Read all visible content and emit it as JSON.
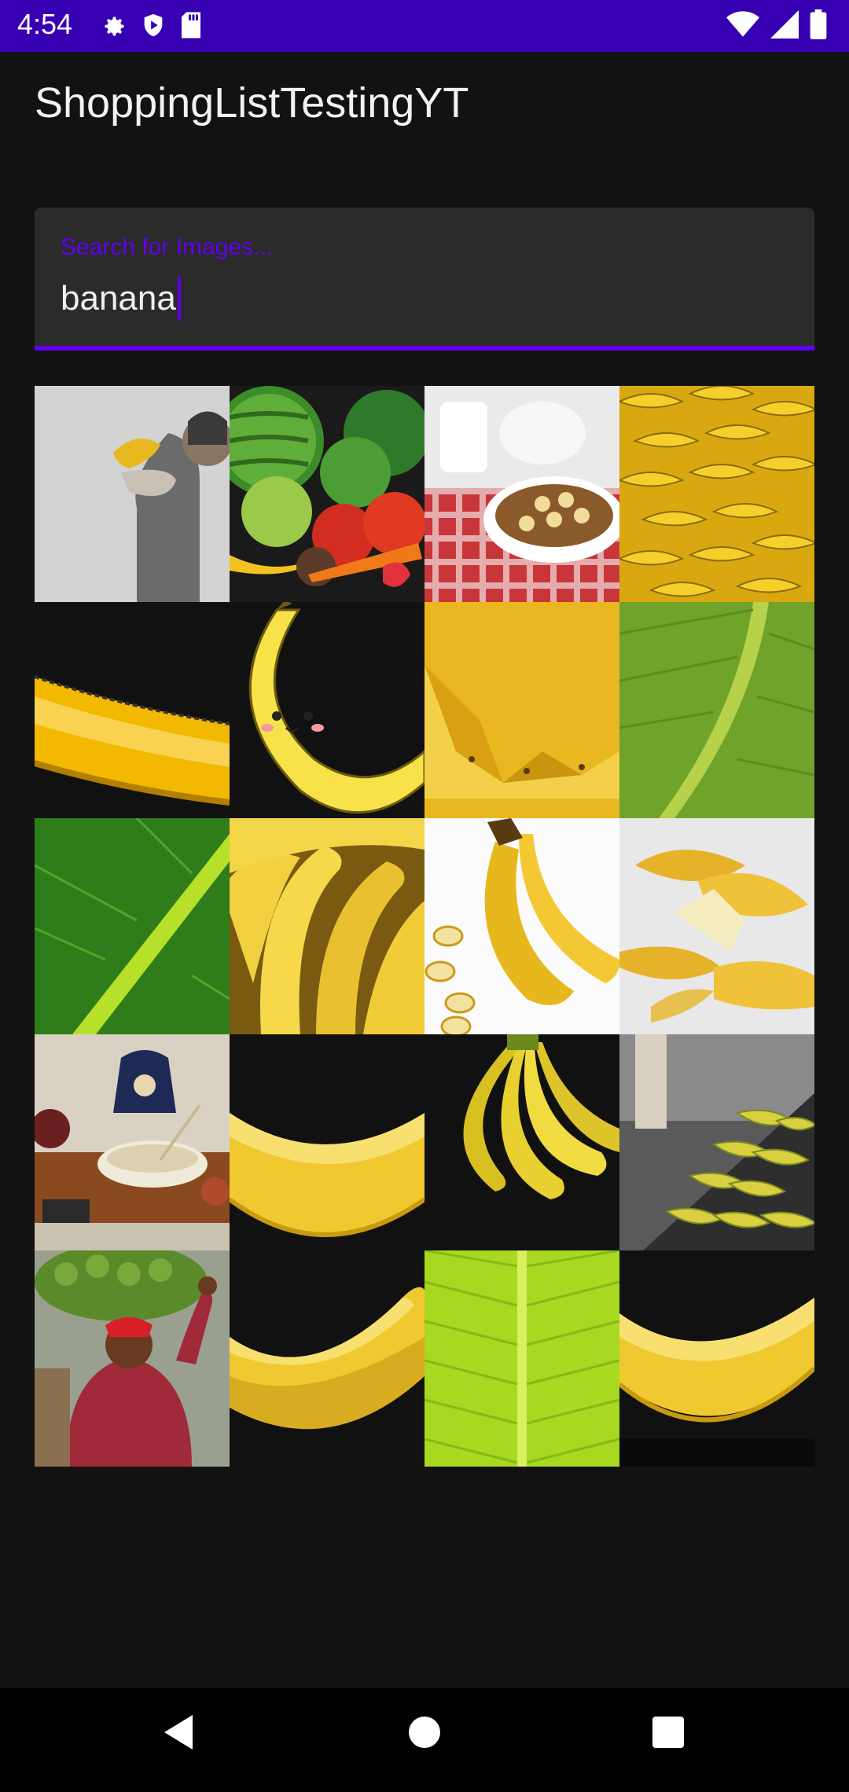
{
  "status_bar": {
    "time": "4:54",
    "left_icons": [
      "settings-icon",
      "shield-play-icon",
      "sd-card-icon"
    ],
    "right_icons": [
      "wifi-icon",
      "signal-icon",
      "battery-icon"
    ]
  },
  "app": {
    "title": "ShoppingListTestingYT",
    "accent_color": "#6200ee",
    "status_bar_color": "#3700b3"
  },
  "search": {
    "label": "Search for Images...",
    "value": "banana"
  },
  "images": [
    "man holding banana like gun",
    "vegetables and fruits illustration",
    "cereal bowl with banana slices",
    "pile of bananas",
    "banana close-up",
    "cartoon smiling banana",
    "low-poly yellow banana",
    "green banana leaf",
    "green banana leaf with light stripe",
    "bunch of bananas close-up",
    "bananas with slices",
    "peeled bananas",
    "breakfast table with porridge",
    "single banana",
    "bunch of bananas on black",
    "bananas at market stall",
    "woman carrying bananas",
    "banana on black",
    "light green banana leaf",
    "single banana on black"
  ],
  "nav": {
    "buttons": [
      "back-icon",
      "home-icon",
      "recents-icon"
    ]
  }
}
